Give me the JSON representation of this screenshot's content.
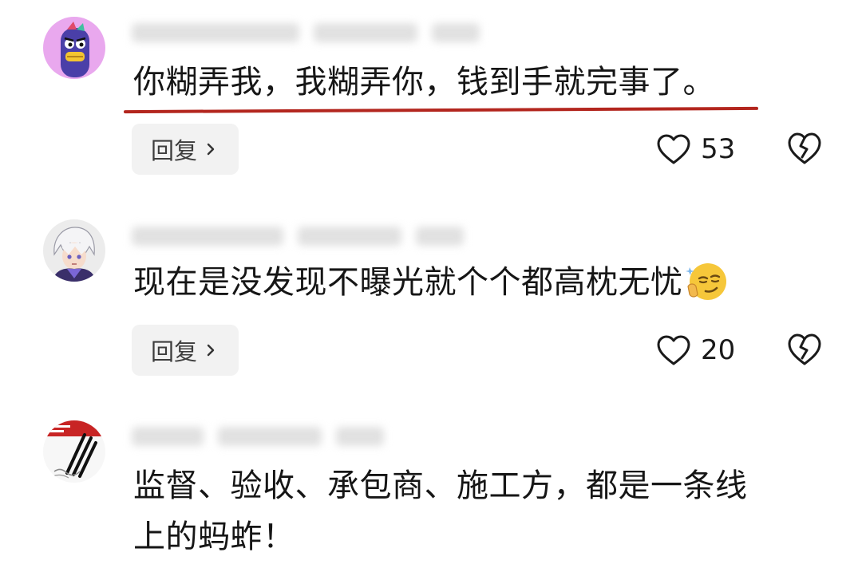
{
  "comments": [
    {
      "text": "你糊弄我，我糊弄你，钱到手就完事了。",
      "reply_label": "回复",
      "likes": "53",
      "avatar_icon": "purple-cartoon-character-avatar",
      "highlight_color": "#b3261e"
    },
    {
      "text": "现在是没发现不曝光就个个都高枕无忧",
      "reply_label": "回复",
      "likes": "20",
      "avatar_icon": "anime-boy-avatar",
      "emoji_icon": "smirking-face-emoji"
    },
    {
      "text_line1": "监督、验收、承包商、施工方，都是一条线",
      "text_line2": "上的蚂蚱！",
      "avatar_icon": "pens-photo-avatar"
    }
  ],
  "icons": {
    "like": "heart-outline-icon",
    "dislike": "broken-heart-icon",
    "reply_arrow": "chevron-right-icon"
  }
}
